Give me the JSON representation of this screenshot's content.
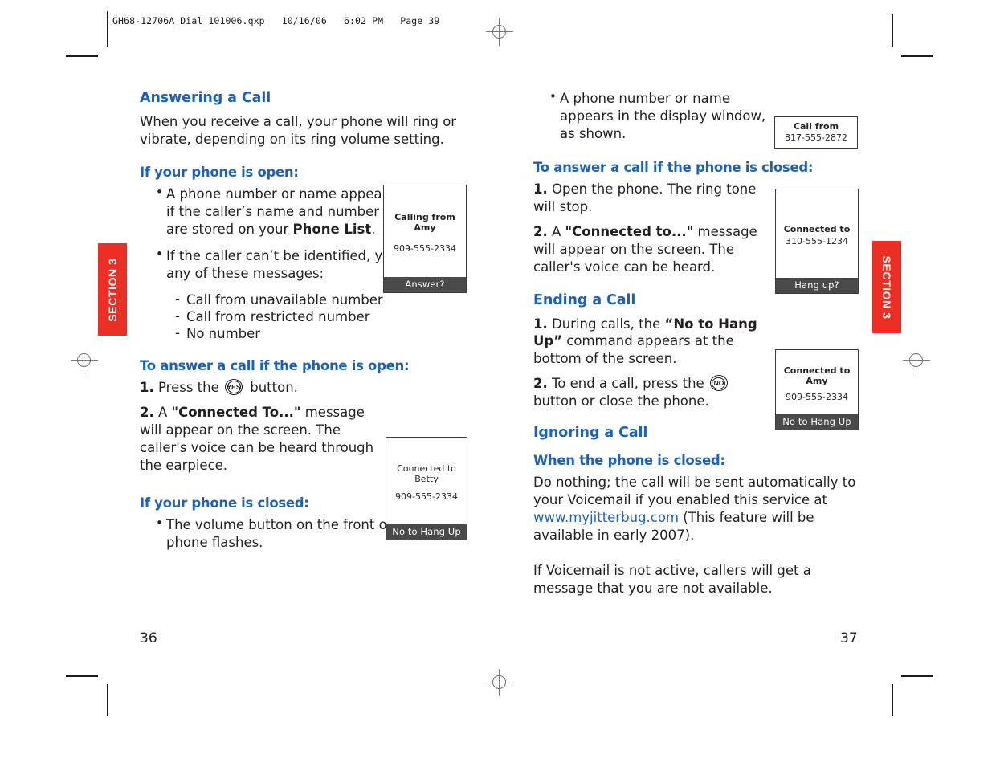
{
  "slug": {
    "text": "GH68-12706A_Dial_101006.qxp   10/16/06   6:02 PM   Page 39"
  },
  "section_tab": {
    "label": "SECTION 3",
    "color": "#ed2e24"
  },
  "theme": {
    "heading_blue": "#1f62b5",
    "body_black": "#231f20",
    "softkey_gray": "#4a4a4a"
  },
  "left_column": {
    "heading": "Answering a Call",
    "intro": "When you receive a call, your phone will ring or vibrate, depending on its ring volume setting.",
    "subhead_open": "If your phone is open:",
    "bullet_1_pre": "A phone number or name appears if the caller’s name and number are stored on your ",
    "bullet_1_bold": "Phone List",
    "bullet_1_post": ".",
    "bullet_2": "If the caller can’t be identified, you will see any of these messages:",
    "dash_items": [
      "Call from unavailable number",
      "Call from restricted number",
      "No number"
    ],
    "subhead_answer_open": "To answer a call if the phone is open:",
    "step1_num": "1.",
    "step1_pre": " Press the ",
    "step1_key": "YES",
    "step1_post": " button.",
    "step2_num": "2.",
    "step2_pre": " A ",
    "step2_bold": "\"Connected To...\"",
    "step2_post": " message will appear on the screen. The caller's voice can be heard through the earpiece.",
    "subhead_closed": "If your phone is closed:",
    "bullet_closed": "The volume button on the front of your phone flashes.",
    "folio": "36"
  },
  "right_column": {
    "bullet_display": "A phone number or name appears in the display window, as shown.",
    "subhead_answer_closed": "To answer a call if the phone is closed:",
    "step1_num": "1.",
    "step1_text": " Open the phone. The ring tone will stop.",
    "step2_num": "2.",
    "step2_pre": " A ",
    "step2_bold": "\"Connected to...\"",
    "step2_post": " message will appear on the screen. The caller's voice can be heard.",
    "heading_ending": "Ending a Call",
    "ending_step1_num": "1.",
    "ending_step1_pre": " During calls, the ",
    "ending_step1_bold": "“No to Hang Up”",
    "ending_step1_post": " command appears at the bottom of the screen.",
    "ending_step2_num": "2.",
    "ending_step2_pre": " To end a call, press the ",
    "ending_step2_key": "NO",
    "ending_step2_post": " button or close the phone.",
    "heading_ignoring": "Ignoring a Call",
    "subhead_when_closed": "When the phone is closed:",
    "ignore_para_pre": "Do nothing; the call will be sent automatically to your Voicemail if you enabled this service at ",
    "ignore_link": "www.myjitterbug.com",
    "ignore_para_post": " (This feature will be available in early 2007).",
    "ignore_para_2": "If Voicemail is not active, callers will get a message that you are not available.",
    "folio": "37"
  },
  "phone_displays": {
    "calling_amy": {
      "line1": "Calling from",
      "line2": "Amy",
      "number": "909-555-2334",
      "softkey": "Answer?"
    },
    "connected_betty": {
      "line1": "Connected to",
      "line2": "Betty",
      "number": "909-555-2334",
      "softkey": "No to Hang Up"
    },
    "call_from": {
      "line1": "Call from",
      "number": "817-555-2872"
    },
    "connected_310": {
      "line1": "Connected to",
      "number": "310-555-1234",
      "softkey": "Hang up?"
    },
    "connected_amy": {
      "line1": "Connected to",
      "line2": "Amy",
      "number": "909-555-2334",
      "softkey": "No to Hang Up"
    }
  }
}
